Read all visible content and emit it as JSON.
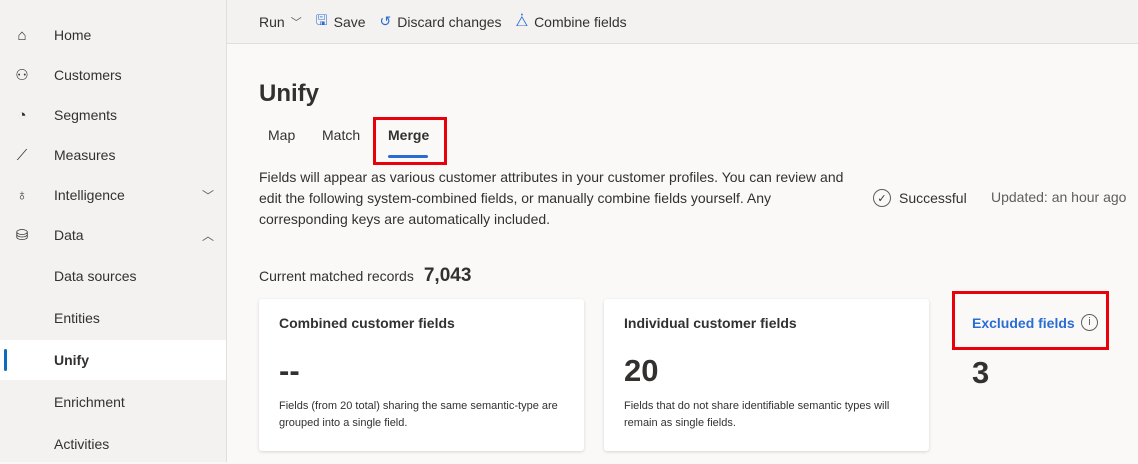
{
  "sidebar": {
    "items": [
      {
        "label": "Home",
        "icon": "home-icon"
      },
      {
        "label": "Customers",
        "icon": "people-icon"
      },
      {
        "label": "Segments",
        "icon": "pie-icon"
      },
      {
        "label": "Measures",
        "icon": "chart-line-icon"
      },
      {
        "label": "Intelligence",
        "icon": "lightbulb-icon"
      },
      {
        "label": "Data",
        "icon": "database-icon"
      },
      {
        "label": "Data sources"
      },
      {
        "label": "Entities"
      },
      {
        "label": "Unify"
      },
      {
        "label": "Enrichment"
      },
      {
        "label": "Activities"
      }
    ]
  },
  "toolbar": {
    "run": "Run",
    "save": "Save",
    "discard": "Discard changes",
    "combine": "Combine fields"
  },
  "page": {
    "title": "Unify",
    "tabs": [
      "Map",
      "Match",
      "Merge"
    ],
    "active_tab": "Merge",
    "description": "Fields will appear as various customer attributes in your customer profiles. You can review and edit the following system-combined fields, or manually combine fields yourself. Any corresponding keys are automatically included.",
    "status": "Successful",
    "updated": "Updated: an hour ago",
    "matched_label": "Current matched records",
    "matched_value": "7,043"
  },
  "cards": [
    {
      "title": "Combined customer fields",
      "value": "--",
      "note": "Fields (from 20 total) sharing the same semantic-type are grouped into a single field."
    },
    {
      "title": "Individual customer fields",
      "value": "20",
      "note": "Fields that do not share identifiable semantic types will remain as single fields."
    }
  ],
  "excluded": {
    "label": "Excluded fields",
    "value": "3"
  },
  "colors": {
    "accent": "#2b6cd4",
    "highlight": "#e8000b"
  }
}
